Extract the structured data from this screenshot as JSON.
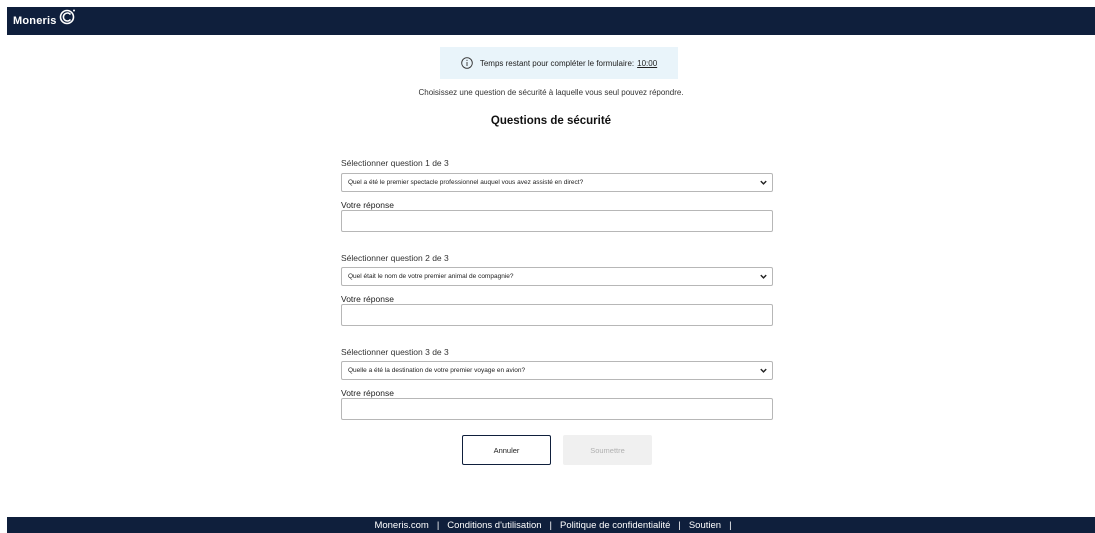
{
  "header": {
    "brand": "Moneris"
  },
  "timer": {
    "text": "Temps restant pour compléter le formulaire:",
    "value": "10:00"
  },
  "intro": "Choisissez une question de sécurité à laquelle vous seul pouvez répondre.",
  "title": "Questions de sécurité",
  "questions": [
    {
      "label": "Sélectionner question 1 de 3",
      "selected": "Quel a été le premier spectacle professionnel auquel vous avez assisté en direct?",
      "answer_label": "Votre réponse",
      "answer_value": ""
    },
    {
      "label": "Sélectionner question 2 de 3",
      "selected": "Quel était le nom de votre premier animal de compagnie?",
      "answer_label": "Votre réponse",
      "answer_value": ""
    },
    {
      "label": "Sélectionner question 3 de 3",
      "selected": "Quelle a été la destination de votre premier voyage en avion?",
      "answer_label": "Votre réponse",
      "answer_value": ""
    }
  ],
  "buttons": {
    "cancel": "Annuler",
    "submit": "Soumettre"
  },
  "footer": {
    "links": [
      "Moneris.com",
      "Conditions d'utilisation",
      "Politique de confidentialité",
      "Soutien"
    ],
    "separator": "|"
  },
  "colors": {
    "navy": "#0f1f3c",
    "timer_bg": "#e9f4fa",
    "disabled_bg": "#f0f0f0"
  }
}
